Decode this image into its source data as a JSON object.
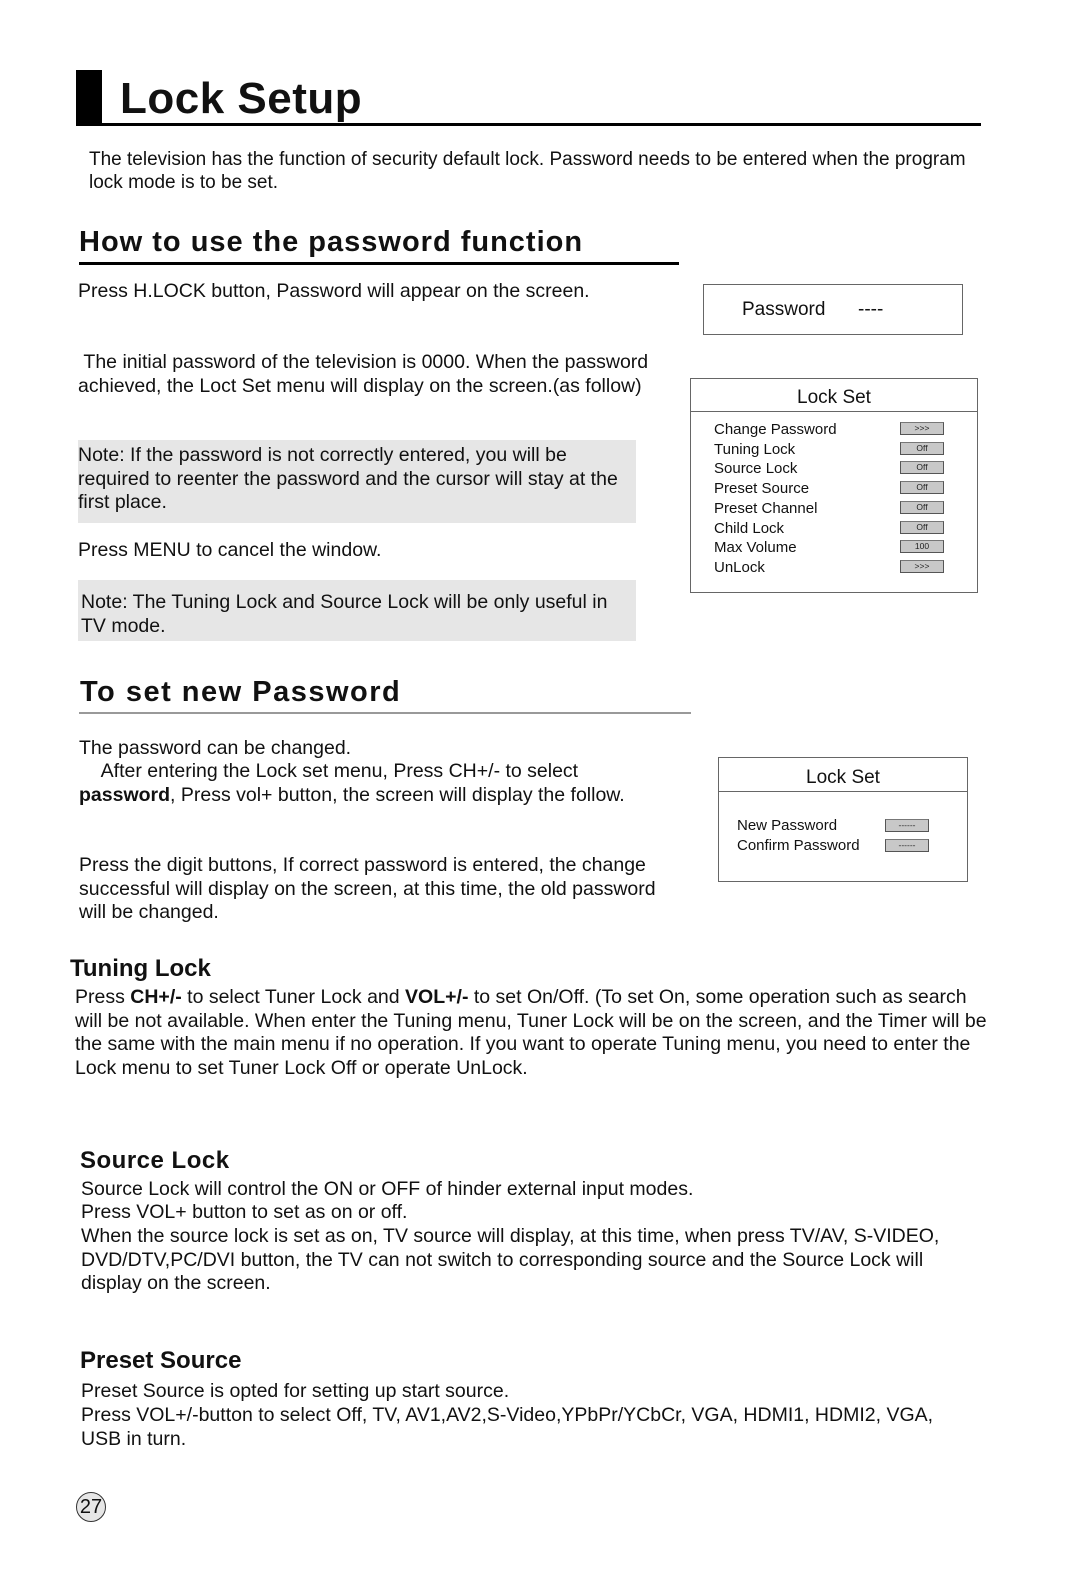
{
  "page": {
    "title": "Lock Setup",
    "intro": "The television has the function of security default lock. Password needs to be entered when the program lock mode is to be set.",
    "page_number": "27"
  },
  "password_section": {
    "heading": "How to use the password function",
    "p1": "Press H.LOCK button, Password will appear on the screen.",
    "p2": " The initial password of the television is 0000. When the password achieved, the Loct Set menu will display on the screen.(as follow)",
    "note1": "Note: If the password is not correctly entered, you will be required to reenter the password and the cursor will stay at the first place.",
    "p3": "Press MENU to cancel the window.",
    "note2": "Note: The Tuning Lock and Source Lock will be only useful in TV mode."
  },
  "password_osd": {
    "label": "Password",
    "value": "----"
  },
  "lock_set_osd": {
    "title": "Lock Set",
    "items": [
      {
        "label": "Change Password",
        "value": ">>>"
      },
      {
        "label": "Tuning Lock",
        "value": "Off"
      },
      {
        "label": "Source Lock",
        "value": "Off"
      },
      {
        "label": "Preset Source",
        "value": "Off"
      },
      {
        "label": "Preset Channel",
        "value": "Off"
      },
      {
        "label": "Child Lock",
        "value": "Off"
      },
      {
        "label": "Max Volume",
        "value": "100"
      },
      {
        "label": "UnLock",
        "value": ">>>"
      }
    ]
  },
  "new_password_section": {
    "heading": "To set new Password",
    "p1": "The password can be changed.",
    "p2_pre": "    After entering the Lock set menu, Press CH+/- to select ",
    "p2_bold": "password",
    "p2_post": ", Press vol+ button, the screen will display the follow.",
    "p3": "Press the digit buttons, If correct password is entered, the change successful will display on the screen, at this time, the old password will be changed."
  },
  "new_password_osd": {
    "title": "Lock Set",
    "items": [
      {
        "label": "New Password",
        "value": "------"
      },
      {
        "label": "Confirm Password",
        "value": "------"
      }
    ]
  },
  "tuning_lock": {
    "heading": "Tuning Lock",
    "t1": "Press ",
    "b1": "CH+/-",
    "t2": " to select Tuner Lock and ",
    "b2": "VOL+/-",
    "t3": " to set On/Off.  (To set On, some operation such as search will be not available. When enter the Tuning menu, Tuner Lock will be on the screen, and the Timer will be the same with the main menu if no operation. If you want to operate Tuning menu, you need to enter the Lock menu to set Tuner Lock Off or operate UnLock."
  },
  "source_lock": {
    "heading": "Source Lock",
    "l1": "Source Lock will control the ON or OFF of hinder external input modes.",
    "l2": "Press VOL+ button to set as on or off.",
    "l3": "When the source lock is set as on, TV source will display, at this time, when press TV/AV, S-VIDEO, DVD/DTV,PC/DVI button, the TV can not switch to corresponding source and the Source Lock will display on the screen."
  },
  "preset_source": {
    "heading": "Preset Source",
    "l1": "Preset Source is opted for setting up start source.",
    "l2": "Press VOL+/-button to select Off, TV, AV1,AV2,S-Video,YPbPr/YCbCr, VGA, HDMI1, HDMI2, VGA, USB in turn."
  }
}
